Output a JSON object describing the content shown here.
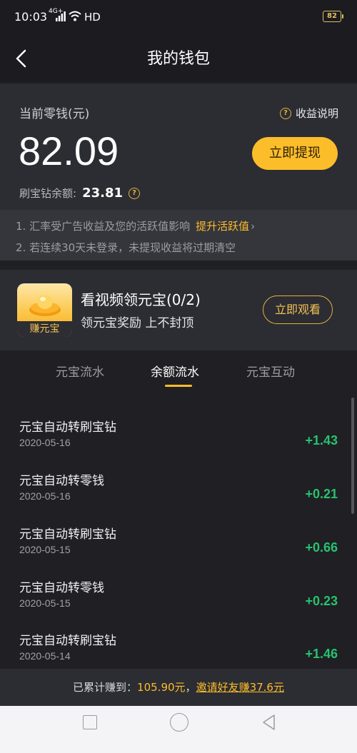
{
  "status_bar": {
    "time": "10:03",
    "network": "4G+",
    "hd": "HD",
    "battery": "82"
  },
  "header": {
    "title": "我的钱包"
  },
  "balance": {
    "label": "当前零钱(元)",
    "explain_label": "收益说明",
    "amount": "82.09",
    "withdraw_label": "立即提现",
    "diamond_label": "刷宝钻余额:",
    "diamond_value": "23.81"
  },
  "notice": {
    "line1": "1. 汇率受广告收益及您的活跃值影响",
    "boost_link": "提升活跃值",
    "line2": "2. 若连续30天未登录，未提现收益将过期清空"
  },
  "promo": {
    "icon_label": "赚元宝",
    "title": "看视频领元宝(0/2)",
    "subtitle": "领元宝奖励 上不封顶",
    "button_label": "立即观看"
  },
  "tabs": [
    {
      "label": "元宝流水",
      "active": false
    },
    {
      "label": "余额流水",
      "active": true
    },
    {
      "label": "元宝互动",
      "active": false
    }
  ],
  "transactions": [
    {
      "title": "元宝自动转刷宝钻",
      "date": "2020-05-16",
      "amount": "+1.43"
    },
    {
      "title": "元宝自动转零钱",
      "date": "2020-05-16",
      "amount": "+0.21"
    },
    {
      "title": "元宝自动转刷宝钻",
      "date": "2020-05-15",
      "amount": "+0.66"
    },
    {
      "title": "元宝自动转零钱",
      "date": "2020-05-15",
      "amount": "+0.23"
    },
    {
      "title": "元宝自动转刷宝钻",
      "date": "2020-05-14",
      "amount": "+1.46"
    }
  ],
  "footer": {
    "prefix": "已累计赚到：",
    "total": "105.90元",
    "separator": "，",
    "invite_link": "邀请好友赚37.6元"
  },
  "colors": {
    "accent": "#fcbd2a",
    "positive": "#28c26e",
    "background": "#1f1f24",
    "card": "#2c2c33"
  }
}
